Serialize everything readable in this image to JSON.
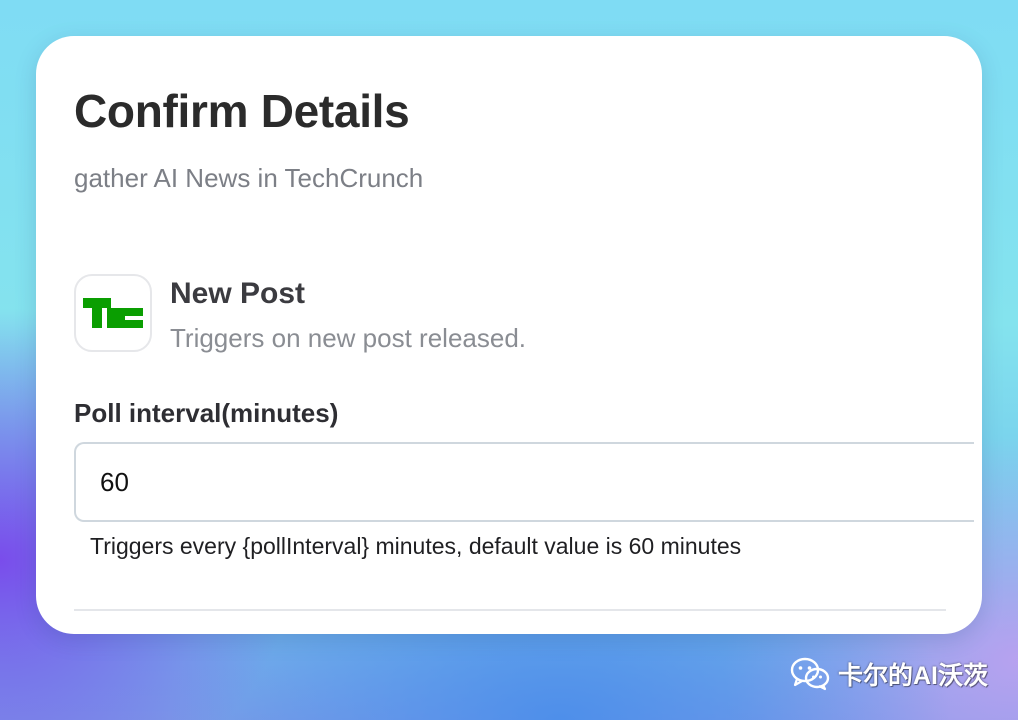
{
  "dialog": {
    "title": "Confirm Details",
    "subtitle": "gather AI News in TechCrunch"
  },
  "trigger": {
    "logo_text": "TC",
    "logo_color": "#0a9e01",
    "title": "New Post",
    "description": "Triggers on new post released."
  },
  "poll_interval": {
    "label": "Poll interval(minutes)",
    "value": "60",
    "hint": "Triggers every {pollInterval} minutes, default value is 60 minutes"
  },
  "watermark": {
    "text": "卡尔的AI沃茨",
    "icon": "wechat-icon"
  },
  "colors": {
    "title": "#2b2b2b",
    "muted": "#8a8d93",
    "input_border": "#cfd7de",
    "card": "#ffffff"
  }
}
